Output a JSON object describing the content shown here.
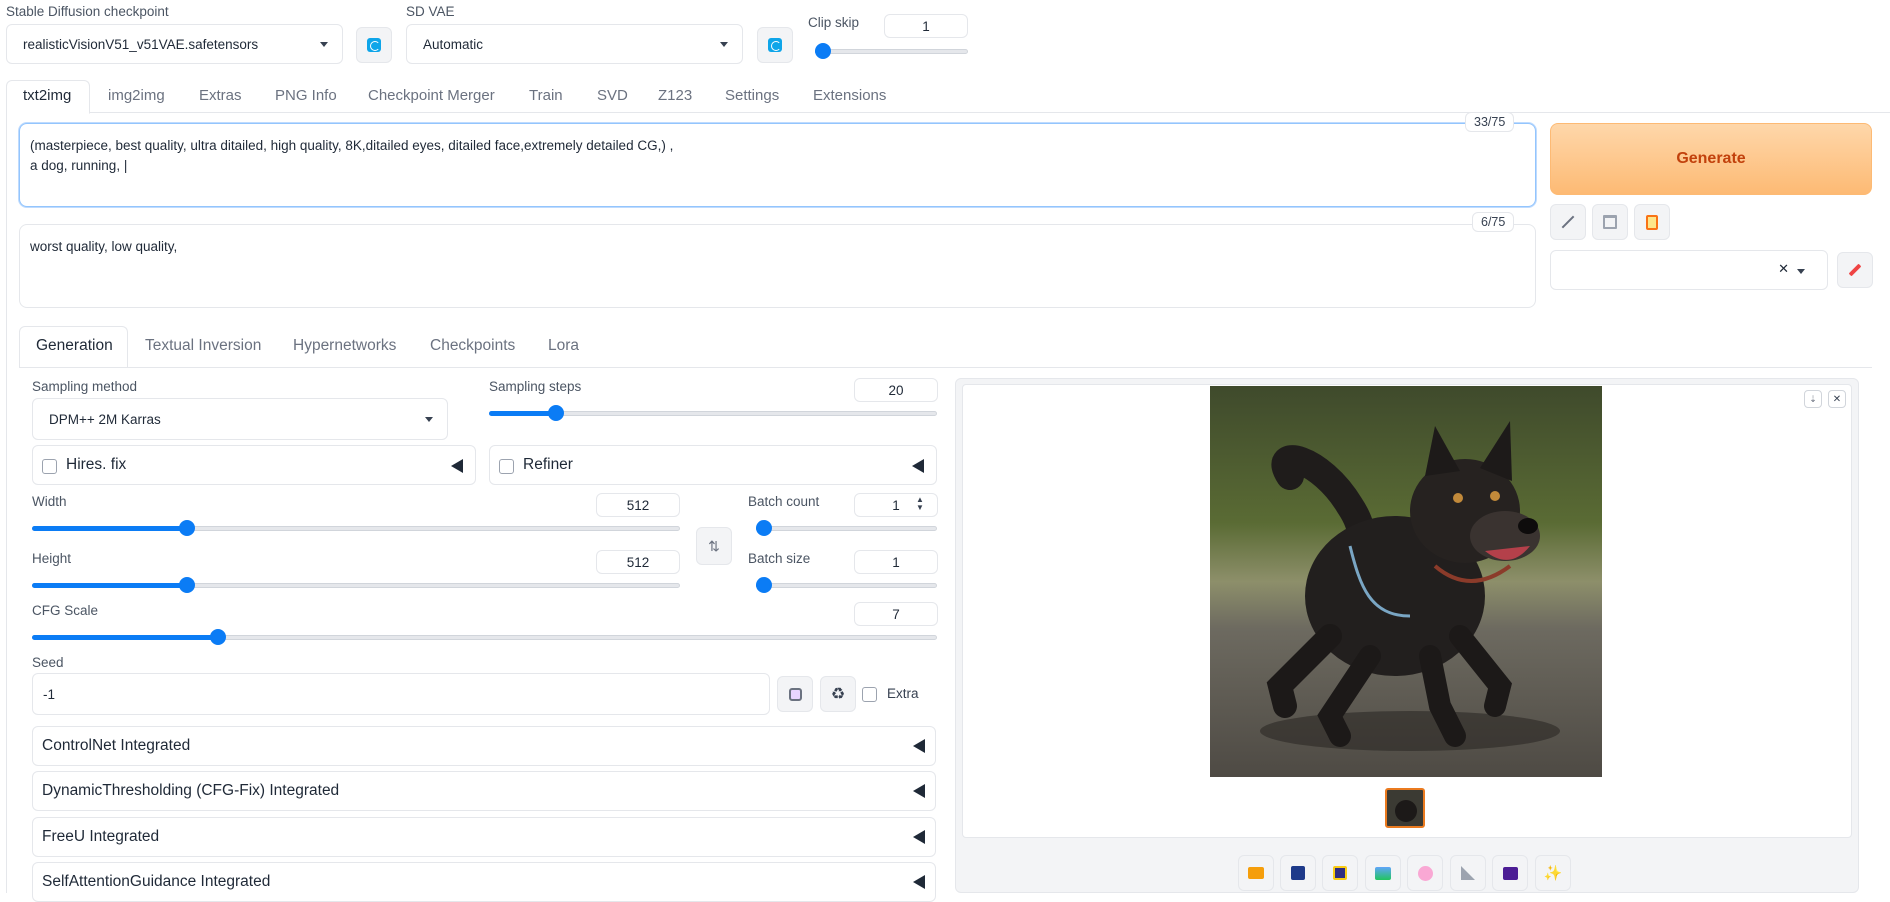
{
  "top": {
    "checkpoint_label": "Stable Diffusion checkpoint",
    "checkpoint_value": "realisticVisionV51_v51VAE.safetensors",
    "vae_label": "SD VAE",
    "vae_value": "Automatic",
    "clip_skip_label": "Clip skip",
    "clip_skip_value": "1",
    "clip_skip_fraction": 0.0
  },
  "tabs": [
    "txt2img",
    "img2img",
    "Extras",
    "PNG Info",
    "Checkpoint Merger",
    "Train",
    "SVD",
    "Z123",
    "Settings",
    "Extensions"
  ],
  "prompt": {
    "line1": "(masterpiece, best quality, ultra ditailed, high quality, 8K,ditailed eyes, ditailed face,extremely detailed CG,) ,",
    "line2": "a dog, running, |",
    "counter": "33/75"
  },
  "negative_prompt": {
    "text": "worst quality, low quality,",
    "counter": "6/75"
  },
  "generate_label": "Generate",
  "style_select": {
    "clear_glyph": "✕"
  },
  "subtabs": [
    "Generation",
    "Textual Inversion",
    "Hypernetworks",
    "Checkpoints",
    "Lora"
  ],
  "gen": {
    "sampling_method_label": "Sampling method",
    "sampling_method_value": "DPM++ 2M Karras",
    "sampling_steps_label": "Sampling steps",
    "sampling_steps_value": "20",
    "sampling_steps_fraction": 0.136,
    "hires_label": "Hires. fix",
    "refiner_label": "Refiner",
    "width_label": "Width",
    "width_value": "512",
    "width_fraction": 0.233,
    "height_label": "Height",
    "height_value": "512",
    "height_fraction": 0.233,
    "batch_count_label": "Batch count",
    "batch_count_value": "1",
    "batch_count_fraction": 0.0,
    "batch_size_label": "Batch size",
    "batch_size_value": "1",
    "batch_size_fraction": 0.0,
    "cfg_label": "CFG Scale",
    "cfg_value": "7",
    "cfg_fraction": 0.2,
    "seed_label": "Seed",
    "seed_value": "-1",
    "extra_label": "Extra"
  },
  "accordions": [
    "ControlNet Integrated",
    "DynamicThresholding (CFG-Fix) Integrated",
    "FreeU Integrated",
    "SelfAttentionGuidance Integrated"
  ],
  "colors": {
    "accent": "#0b7cf5",
    "generate_bg": "#fdba74",
    "generate_text": "#c2410c",
    "thumb_border": "#ea7a1f"
  },
  "gallery_buttons": [
    "folder-icon",
    "save-icon",
    "zip-icon",
    "send-to-img2img-icon",
    "send-to-inpaint-icon",
    "send-to-extras-icon",
    "video-icon",
    "sparkle-icon"
  ]
}
